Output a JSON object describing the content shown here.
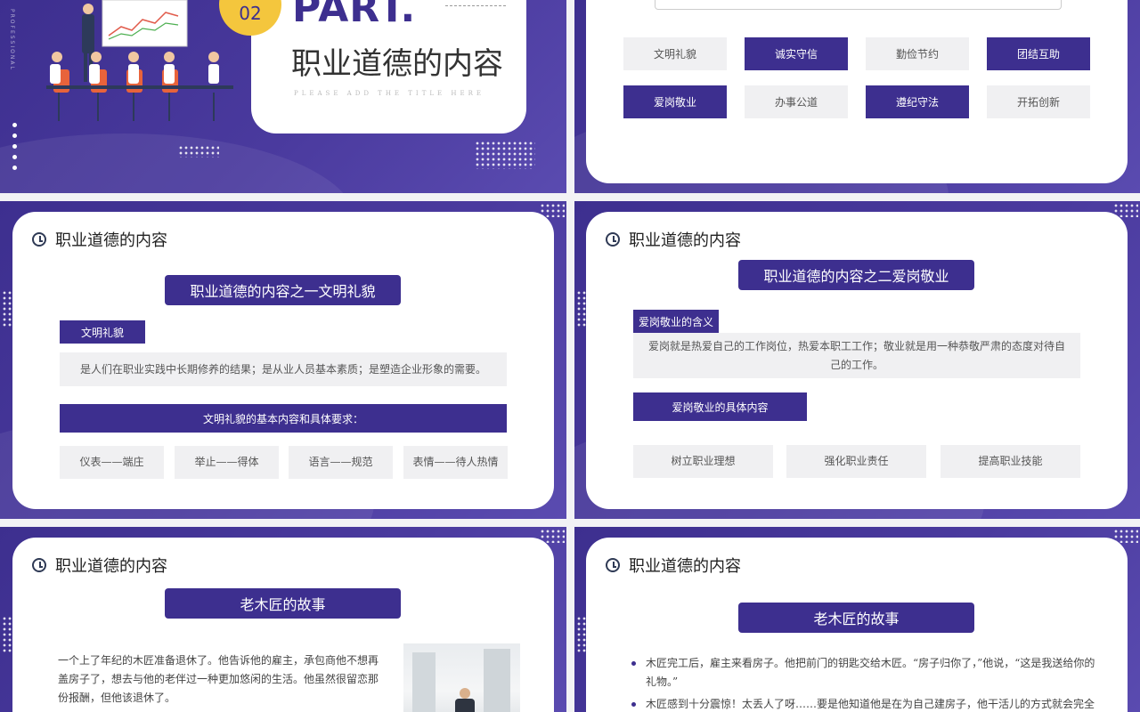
{
  "slide1": {
    "part_number": "02",
    "part_label": "PART.",
    "title": "职业道德的内容",
    "subtitle": "PLEASE ADD THE TITLE HERE",
    "side_text": "PROFESSIONAL"
  },
  "slide2": {
    "items": [
      {
        "label": "文明礼貌",
        "style": "light"
      },
      {
        "label": "诚实守信",
        "style": "dark"
      },
      {
        "label": "勤俭节约",
        "style": "light"
      },
      {
        "label": "团结互助",
        "style": "dark"
      },
      {
        "label": "爱岗敬业",
        "style": "dark"
      },
      {
        "label": "办事公道",
        "style": "light"
      },
      {
        "label": "遵纪守法",
        "style": "dark"
      },
      {
        "label": "开拓创新",
        "style": "light"
      }
    ]
  },
  "slide3": {
    "header": "职业道德的内容",
    "pill": "职业道德的内容之一文明礼貌",
    "tag": "文明礼貌",
    "desc": "是人们在职业实践中长期修养的结果；是从业人员基本素质；是塑造企业形象的需要。",
    "bar": "文明礼貌的基本内容和具体要求：",
    "boxes": [
      "仪表——端庄",
      "举止——得体",
      "语言——规范",
      "表情——待人热情"
    ]
  },
  "slide4": {
    "header": "职业道德的内容",
    "pill": "职业道德的内容之二爱岗敬业",
    "tag": "爱岗敬业的含义",
    "desc": "爱岗就是热爱自己的工作岗位，热爱本职工工作；敬业就是用一种恭敬严肃的态度对待自己的工作。",
    "bar": "爱岗敬业的具体内容",
    "boxes": [
      "树立职业理想",
      "强化职业责任",
      "提高职业技能"
    ]
  },
  "slide5": {
    "header": "职业道德的内容",
    "pill": "老木匠的故事",
    "story": "一个上了年纪的木匠准备退休了。他告诉他的雇主，承包商他不想再盖房子了，想去与他的老伴过一种更加悠闲的生活。他虽然很留恋那份报酬，但他该退休了。"
  },
  "slide6": {
    "header": "职业道德的内容",
    "pill": "老木匠的故事",
    "bullets": [
      "木匠完工后，雇主来看房子。他把前门的钥匙交给木匠。“房子归你了，”他说，“这是我送给你的礼物。”",
      "木匠感到十分震惊！太丢人了呀……要是他知道他是在为自己建房子，他干活儿的方式就会完全"
    ]
  },
  "colors": {
    "primary": "#3d2f8f",
    "accent": "#f4c63d",
    "light_box": "#f0f0f2"
  }
}
